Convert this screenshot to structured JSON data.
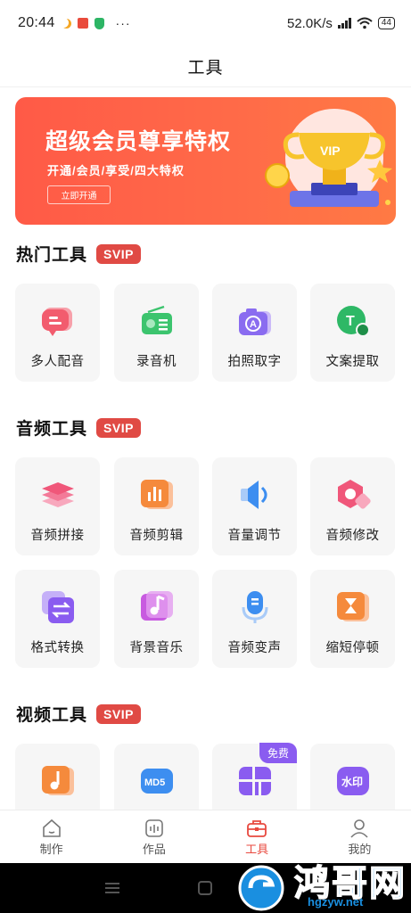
{
  "status_bar": {
    "time": "20:44",
    "dots": "···",
    "speed": "52.0K/s",
    "battery": "44"
  },
  "header": {
    "title": "工具"
  },
  "banner": {
    "title": "超级会员尊享特权",
    "subtitle": "开通/会员/享受/四大特权",
    "button": "立即开通",
    "art_text": "VIP"
  },
  "sections": {
    "hot": {
      "title": "热门工具",
      "badge": "SVIP",
      "items": [
        {
          "label": "多人配音",
          "icon": "dubbing-chat-icon",
          "color": "#f25c6e"
        },
        {
          "label": "录音机",
          "icon": "radio-recorder-icon",
          "color": "#3cc46e"
        },
        {
          "label": "拍照取字",
          "icon": "camera-text-icon",
          "color": "#8a6cf0"
        },
        {
          "label": "文案提取",
          "icon": "text-extract-icon",
          "color": "#2eb866"
        }
      ]
    },
    "audio": {
      "title": "音频工具",
      "badge": "SVIP",
      "items": [
        {
          "label": "音频拼接",
          "icon": "layers-icon",
          "color": "#f0577a"
        },
        {
          "label": "音频剪辑",
          "icon": "audio-bars-icon",
          "color": "#f58a3c"
        },
        {
          "label": "音量调节",
          "icon": "speaker-icon",
          "color": "#3d8ef0"
        },
        {
          "label": "音频修改",
          "icon": "hexagon-edit-icon",
          "color": "#f0577a"
        },
        {
          "label": "格式转换",
          "icon": "convert-icon",
          "color": "#8a5cf0"
        },
        {
          "label": "背景音乐",
          "icon": "music-note-icon",
          "color": "#c85ae0"
        },
        {
          "label": "音频变声",
          "icon": "microphone-icon",
          "color": "#3d8ef0"
        },
        {
          "label": "缩短停顿",
          "icon": "hourglass-icon",
          "color": "#f58a3c"
        }
      ]
    },
    "video": {
      "title": "视频工具",
      "badge": "SVIP",
      "free_badge": "免费",
      "items": [
        {
          "icon": "video-music-icon",
          "color": "#f58a3c"
        },
        {
          "icon": "md5-icon",
          "color": "#3d8ef0",
          "text": "MD5"
        },
        {
          "icon": "grid-icon",
          "color": "#8a5cf0"
        },
        {
          "icon": "watermark-icon",
          "color": "#8a5cf0",
          "text": "水印"
        }
      ]
    }
  },
  "bottom_nav": [
    {
      "label": "制作",
      "icon": "home-icon",
      "active": false
    },
    {
      "label": "作品",
      "icon": "works-icon",
      "active": false
    },
    {
      "label": "工具",
      "icon": "toolbox-icon",
      "active": true
    },
    {
      "label": "我的",
      "icon": "profile-icon",
      "active": false
    }
  ],
  "watermark": {
    "text": "鸿哥网",
    "url": "hgzyw.net"
  }
}
